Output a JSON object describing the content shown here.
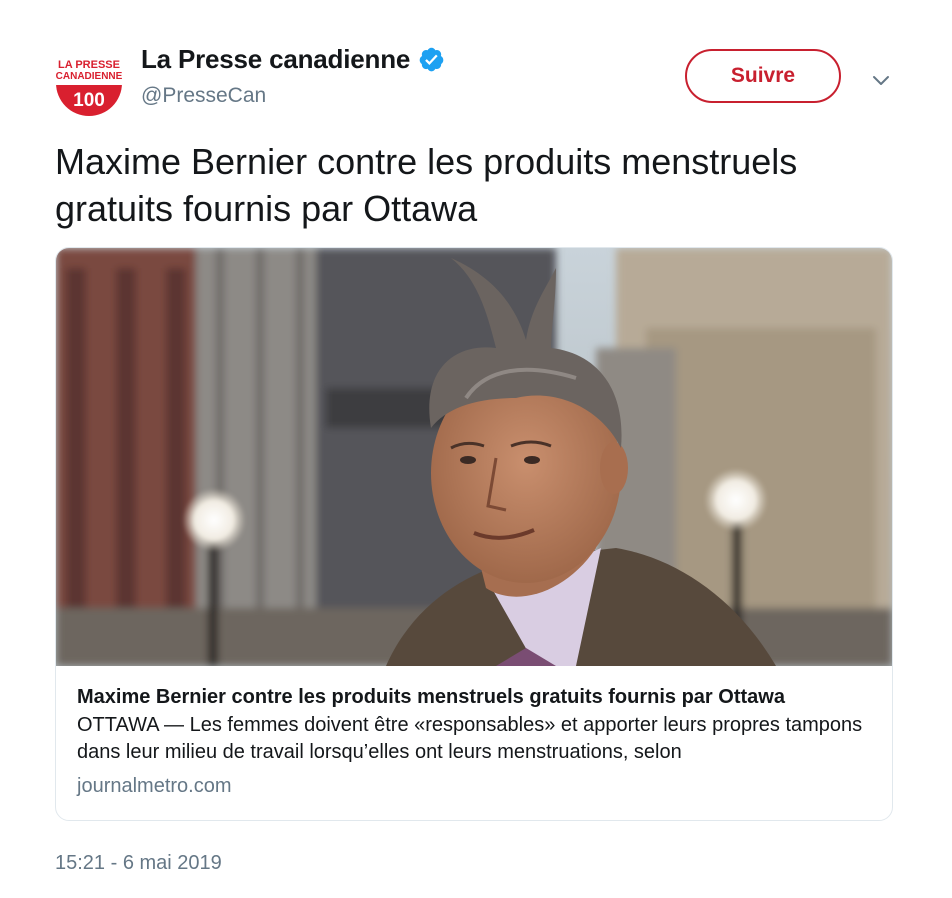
{
  "author": {
    "display_name": "La Presse canadienne",
    "handle": "@PresseCan",
    "verified": true,
    "logo": {
      "line1": "LA PRESSE",
      "line2": "CANADIENNE",
      "number": "100"
    }
  },
  "follow_button": {
    "label": "Suivre"
  },
  "tweet": {
    "text": "Maxime Bernier contre les produits menstruels gratuits fournis par Ottawa",
    "timestamp": "15:21 - 6 mai 2019"
  },
  "card": {
    "image_icon": "photo-of-man-with-spiky-hair-icon",
    "title": "Maxime Bernier contre les produits menstruels gratuits fournis par Ottawa",
    "description": "OTTAWA — Les femmes doivent être «responsables» et apporter leurs propres tampons dans leur milieu de travail lorsqu’elles ont leurs menstruations, selon",
    "domain": "journalmetro.com"
  },
  "colors": {
    "accent": "#c8202f",
    "verified": "#1da1f2",
    "secondary_text": "#657786",
    "border": "#e1e8ed"
  }
}
